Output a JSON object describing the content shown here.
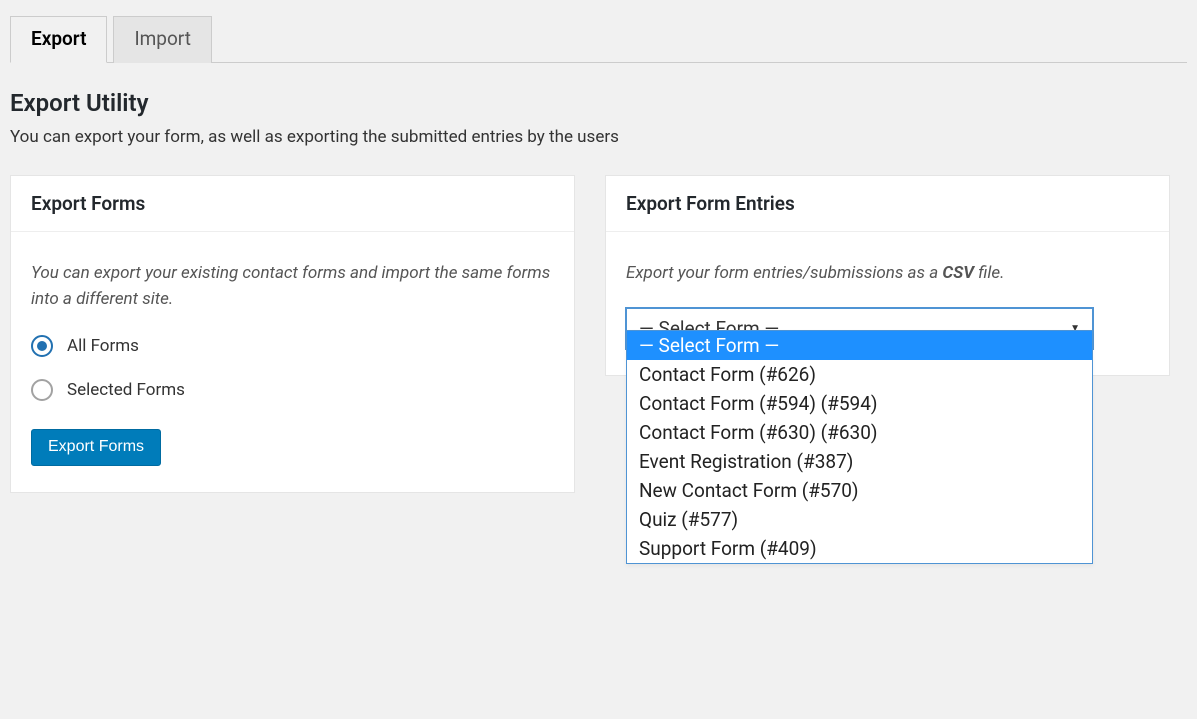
{
  "tabs": {
    "export": "Export",
    "import": "Import"
  },
  "page": {
    "title": "Export Utility",
    "description": "You can export your form, as well as exporting the submitted entries by the users"
  },
  "exportForms": {
    "title": "Export Forms",
    "description": "You can export your existing contact forms and import the same forms into a different site.",
    "radio_all": "All Forms",
    "radio_selected": "Selected Forms",
    "button": "Export Forms"
  },
  "exportEntries": {
    "title": "Export Form Entries",
    "description_pre": "Export your form entries/submissions as a ",
    "description_bold": "CSV",
    "description_post": " file.",
    "select_placeholder": "— Select Form —",
    "options": [
      "— Select Form —",
      "Contact Form (#626)",
      "Contact Form (#594) (#594)",
      "Contact Form (#630) (#630)",
      "Event Registration (#387)",
      "New Contact Form (#570)",
      "Quiz (#577)",
      "Support Form (#409)"
    ]
  }
}
